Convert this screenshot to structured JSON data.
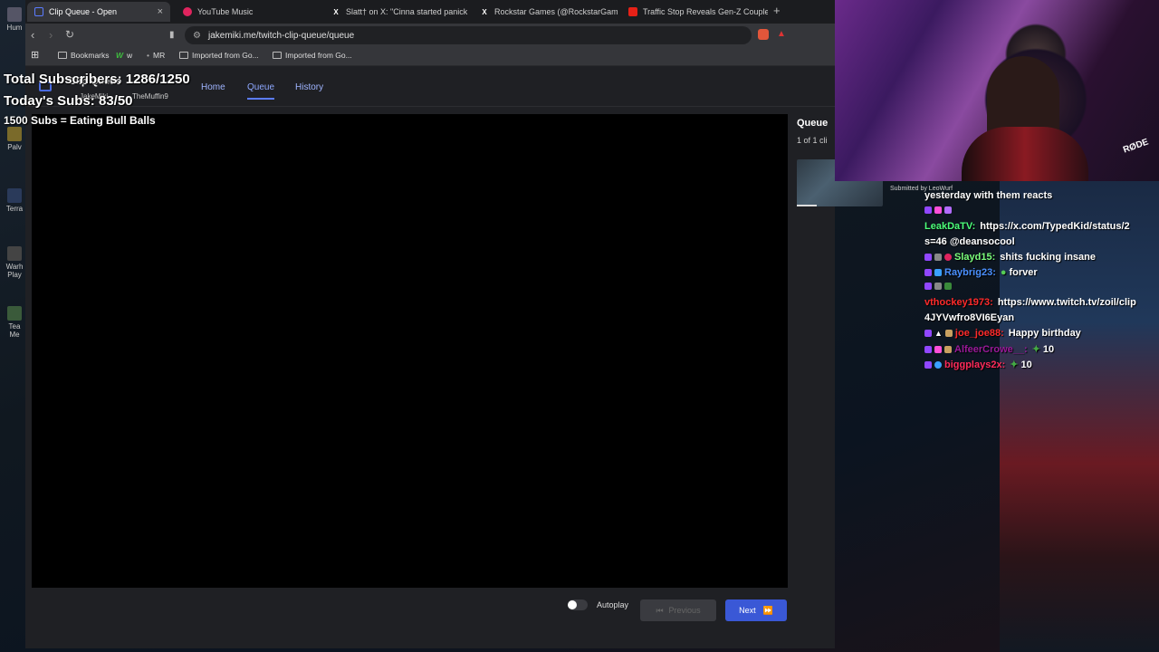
{
  "desktop": {
    "icons": [
      {
        "label": "Hum"
      },
      {
        "label": "Palv"
      },
      {
        "label": "Terra"
      },
      {
        "label": "Warh\nPlay"
      },
      {
        "label": "Tea\nMe"
      }
    ]
  },
  "browser": {
    "tabs": [
      {
        "title": "Clip Queue - Open",
        "icon": "clip-queue-favicon",
        "color": "#5b7cff"
      },
      {
        "title": "YouTube Music",
        "icon": "youtube-music-favicon",
        "color": "#e0245e"
      },
      {
        "title": "Slatt† on X: \"Cinna started panick",
        "icon": "x-favicon",
        "color": "#ffffff"
      },
      {
        "title": "Rockstar Games (@RockstarGames) /",
        "icon": "x-favicon",
        "color": "#ffffff"
      },
      {
        "title": "Traffic Stop Reveals Gen-Z Couple's T",
        "icon": "youtube-favicon",
        "color": "#e62117"
      }
    ],
    "new_tab": "+",
    "url": "jakemiki.me/twitch-clip-queue/queue",
    "bookmarks": [
      {
        "label": "Bookmarks",
        "icon": "folder-icon"
      },
      {
        "label": "w",
        "icon": "w-icon"
      },
      {
        "label": "MR",
        "icon": "mr-icon"
      },
      {
        "label": "Imported from Go...",
        "icon": "folder-icon"
      },
      {
        "label": "Imported from Go...",
        "icon": "folder-icon"
      }
    ]
  },
  "app": {
    "title": "Clip Queue",
    "users": [
      "JakeMiki",
      "TheMuffin9"
    ],
    "nav": [
      {
        "label": "Home"
      },
      {
        "label": "Queue"
      },
      {
        "label": "History"
      }
    ],
    "queue": {
      "title": "Queue",
      "count": "1 of 1 cli"
    },
    "controls": {
      "autoplay_label": "Autoplay",
      "previous_label": "Previous",
      "next_label": "Next"
    }
  },
  "overlay": {
    "total_subs": "Total Subscribers: 1286/1250",
    "today_subs": "Today's Subs: 83/50",
    "goal": "1500 Subs = Eating Bull Balls"
  },
  "webcam": {
    "mic_brand": "RØDE",
    "submitted_by": "Submitted by LeoWurf"
  },
  "chat": [
    {
      "user": "",
      "user_color": "#ffffff",
      "message": "yesterday with them reacts"
    },
    {
      "user": "",
      "user_color": "#ffffff",
      "message": ""
    },
    {
      "user": "LeakDaTV:",
      "user_color": "#4cff7a",
      "message": "https://x.com/TypedKid/status/2"
    },
    {
      "user": "",
      "user_color": "#ffffff",
      "message": "s=46 @deansocool"
    },
    {
      "user": "Slayd15:",
      "user_color": "#7cff7c",
      "message": "shits fucking insane"
    },
    {
      "user": "Raybrig23:",
      "user_color": "#4a90ff",
      "message": "forver"
    },
    {
      "user": "",
      "user_color": "#ffffff",
      "message": ""
    },
    {
      "user": "vthockey1973:",
      "user_color": "#ff2a2a",
      "message": "https://www.twitch.tv/zoil/clip"
    },
    {
      "user": "",
      "user_color": "#ffffff",
      "message": "4JYVwfro8VI6Eyan"
    },
    {
      "user": "joe_joe88:",
      "user_color": "#ff2a2a",
      "message": "Happy birthday"
    },
    {
      "user": "AlfeerCrowe__:",
      "user_color": "#9a1a9a",
      "message": "10"
    },
    {
      "user": "biggplays2x:",
      "user_color": "#ff2a5a",
      "message": "10"
    }
  ]
}
